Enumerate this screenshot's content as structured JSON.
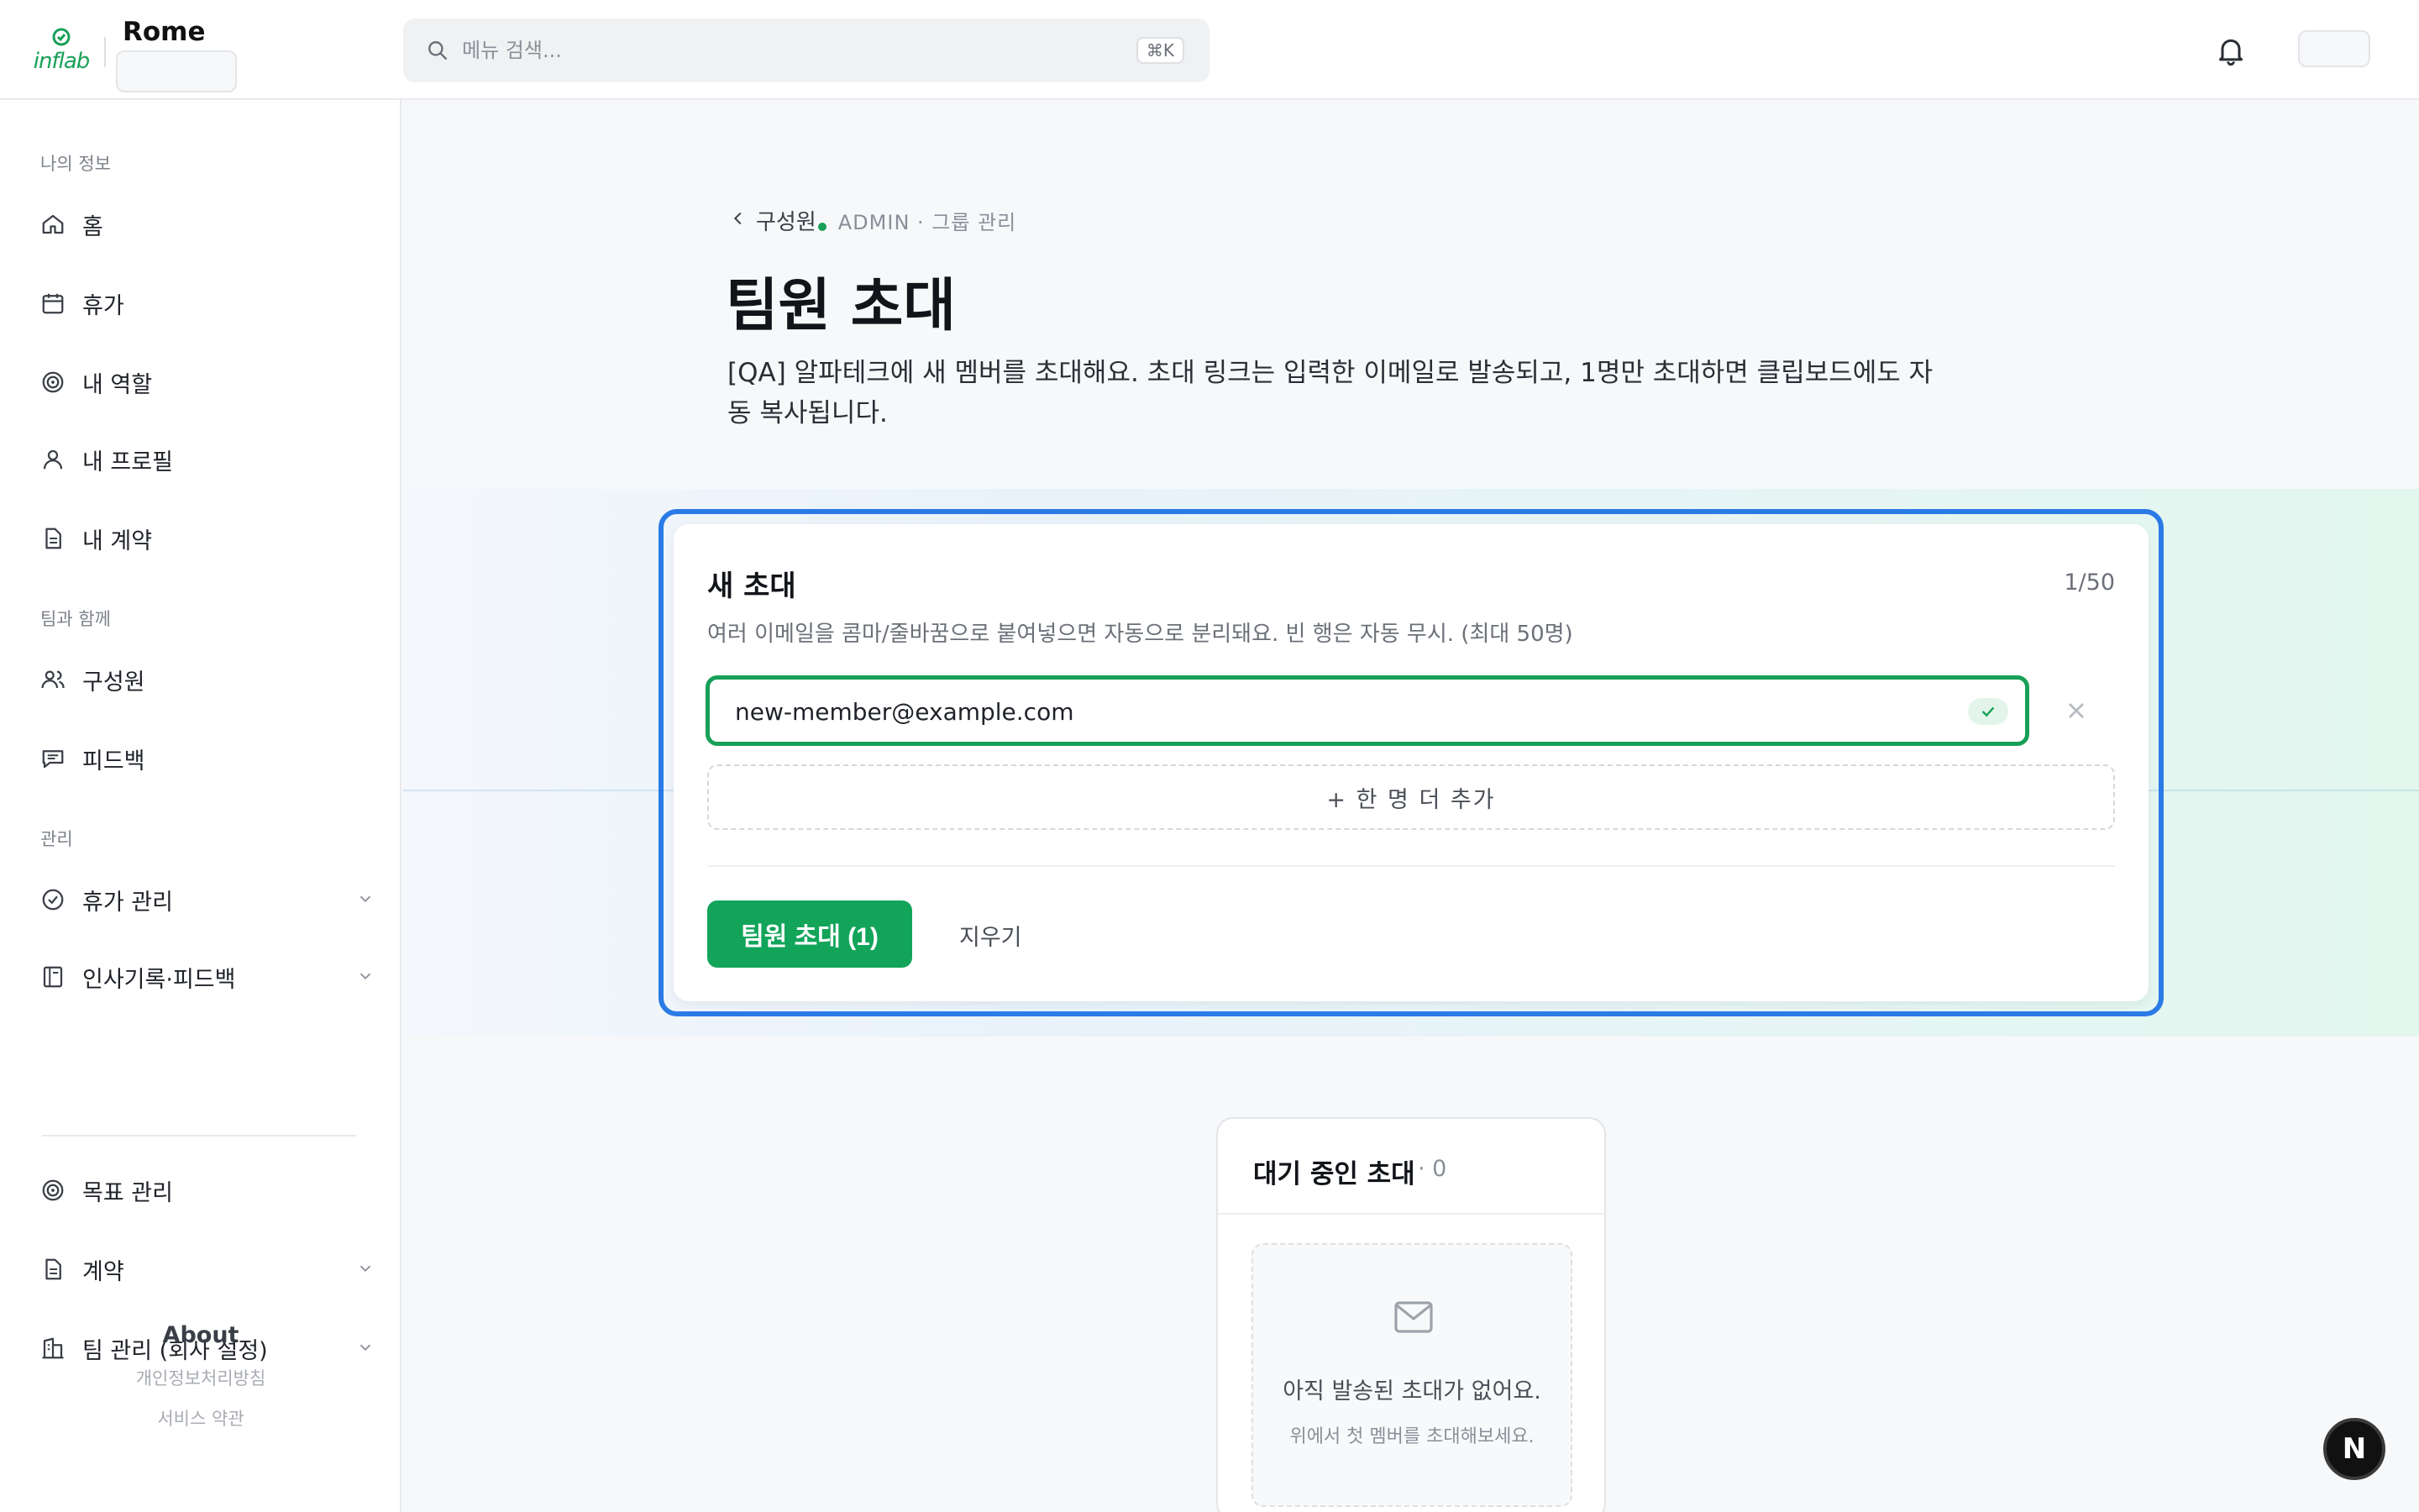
{
  "header": {
    "logo_text": "inflab",
    "org_name": "Rome",
    "search_placeholder": "메뉴 검색...",
    "search_shortcut": "⌘K"
  },
  "sidebar": {
    "groups": [
      {
        "label": "나의 정보",
        "items": [
          {
            "label": "홈",
            "icon": "home-icon"
          },
          {
            "label": "휴가",
            "icon": "calendar-icon"
          },
          {
            "label": "내 역할",
            "icon": "target-icon"
          },
          {
            "label": "내 프로필",
            "icon": "user-icon"
          },
          {
            "label": "내 계약",
            "icon": "document-icon"
          }
        ]
      },
      {
        "label": "팀과 함께",
        "items": [
          {
            "label": "구성원",
            "icon": "users-icon"
          },
          {
            "label": "피드백",
            "icon": "message-icon"
          }
        ]
      },
      {
        "label": "관리",
        "items": [
          {
            "label": "휴가 관리",
            "icon": "check-circle-icon",
            "expandable": true
          },
          {
            "label": "인사기록·피드백",
            "icon": "book-icon",
            "expandable": true
          },
          {
            "label": "목표 관리",
            "icon": "target-icon"
          },
          {
            "label": "계약",
            "icon": "document-icon",
            "expandable": true
          },
          {
            "label": "팀 관리 (회사 설정)",
            "icon": "building-icon",
            "expandable": true
          }
        ]
      }
    ],
    "about": {
      "title": "About",
      "links": [
        "개인정보처리방침",
        "서비스 약관"
      ]
    }
  },
  "main": {
    "breadcrumb": {
      "back_label": "구성원",
      "meta": "ADMIN · 그룹 관리"
    },
    "title": "팀원 초대",
    "description": "[QA] 알파테크에 새 멤버를 초대해요. 초대 링크는 입력한 이메일로 발송되고, 1명만 초대하면 클립보드에도 자동 복사됩니다.",
    "invite_card": {
      "title": "새 초대",
      "count": "1/50",
      "hint": "여러 이메일을 콤마/줄바꿈으로 붙여넣으면 자동으로 분리돼요. 빈 행은 자동 무시. (최대 50명)",
      "email_value": "new-member@example.com",
      "add_row_label": "+ 한 명 더 추가",
      "submit_label": "팀원 초대 (1)",
      "clear_label": "지우기"
    },
    "pending": {
      "title": "대기 중인 초대",
      "count": "· 0",
      "empty_title": "아직 발송된 초대가 없어요.",
      "empty_subtitle": "위에서 첫 멤버를 초대해보세요."
    }
  },
  "fab_label": "N",
  "colors": {
    "brand_green": "#18a058",
    "focus_blue": "#2b7be6",
    "button_green": "#12a55a"
  }
}
